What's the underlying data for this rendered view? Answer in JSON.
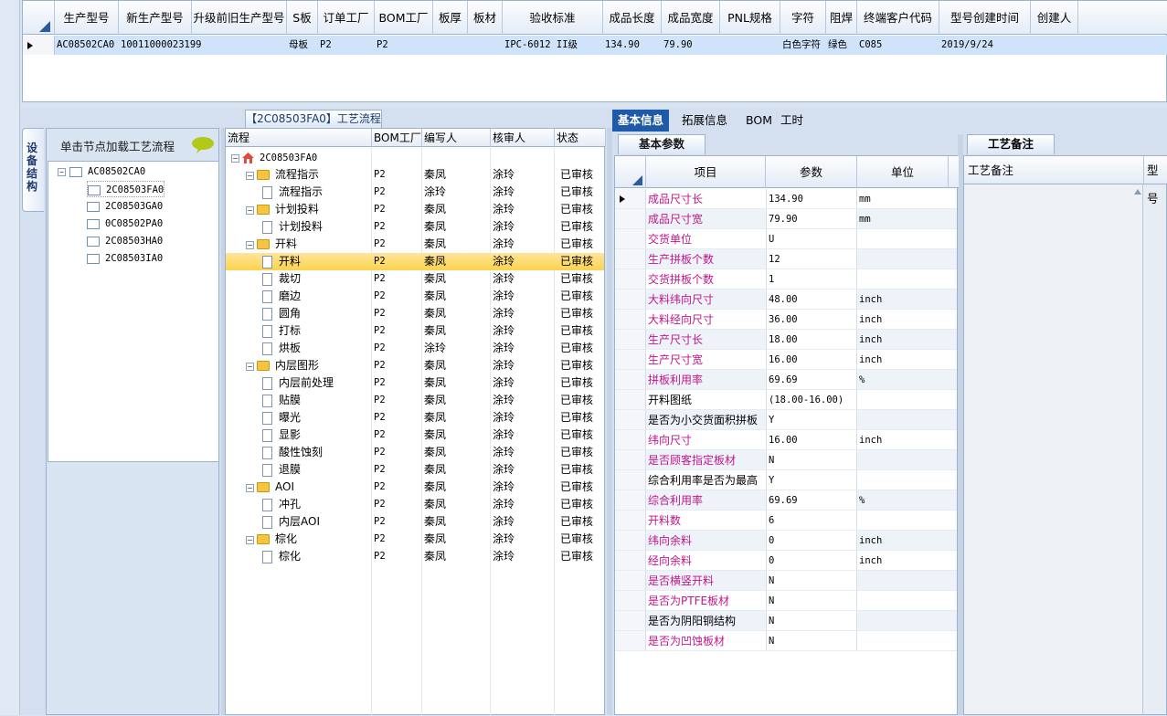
{
  "top_grid": {
    "columns": [
      "生产型号",
      "新生产型号",
      "升级前旧生产型号",
      "S板",
      "订单工厂",
      "BOM工厂",
      "板厚",
      "板材",
      "验收标准",
      "成品长度",
      "成品宽度",
      "PNL规格",
      "字符",
      "阻焊",
      "终端客户代码",
      "型号创建时间",
      "创建人"
    ],
    "row": [
      "AC08502CA0",
      "10011000023199",
      "",
      "母板",
      "P2",
      "P2",
      "",
      "",
      "IPC-6012 II级",
      "134.90",
      "79.90",
      "",
      "白色字符",
      "绿色",
      "C085",
      "2019/9/24",
      ""
    ]
  },
  "left": {
    "vtab_label": "设备结构",
    "hint": "单击节点加载工艺流程",
    "tree_root": "AC08502CA0",
    "tree_children": [
      "2C08503FA0",
      "2C08503GA0",
      "0C08502PA0",
      "2C08503HA0",
      "2C08503IA0"
    ]
  },
  "process": {
    "tab_title": "【2C08503FA0】工艺流程",
    "columns": [
      "流程",
      "BOM工厂",
      "编写人",
      "核审人",
      "状态"
    ],
    "root": "2C08503FA0",
    "rows": [
      {
        "name": "流程指示",
        "level": 1,
        "type": "folder",
        "bom": "P2",
        "writer": "秦凤",
        "reviewer": "涂玲",
        "status": "已审核"
      },
      {
        "name": "流程指示",
        "level": 2,
        "type": "doc",
        "bom": "P2",
        "writer": "涂玲",
        "reviewer": "涂玲",
        "status": "已审核"
      },
      {
        "name": "计划投料",
        "level": 1,
        "type": "folder",
        "bom": "P2",
        "writer": "秦凤",
        "reviewer": "涂玲",
        "status": "已审核"
      },
      {
        "name": "计划投料",
        "level": 2,
        "type": "doc",
        "bom": "P2",
        "writer": "秦凤",
        "reviewer": "涂玲",
        "status": "已审核"
      },
      {
        "name": "开料",
        "level": 1,
        "type": "folder",
        "bom": "P2",
        "writer": "秦凤",
        "reviewer": "涂玲",
        "status": "已审核"
      },
      {
        "name": "开料",
        "level": 2,
        "type": "doc",
        "bom": "P2",
        "writer": "秦凤",
        "reviewer": "涂玲",
        "status": "已审核",
        "selected": true
      },
      {
        "name": "裁切",
        "level": 2,
        "type": "doc",
        "bom": "P2",
        "writer": "秦凤",
        "reviewer": "涂玲",
        "status": "已审核"
      },
      {
        "name": "磨边",
        "level": 2,
        "type": "doc",
        "bom": "P2",
        "writer": "秦凤",
        "reviewer": "涂玲",
        "status": "已审核"
      },
      {
        "name": "圆角",
        "level": 2,
        "type": "doc",
        "bom": "P2",
        "writer": "秦凤",
        "reviewer": "涂玲",
        "status": "已审核"
      },
      {
        "name": "打标",
        "level": 2,
        "type": "doc",
        "bom": "P2",
        "writer": "秦凤",
        "reviewer": "涂玲",
        "status": "已审核"
      },
      {
        "name": "烘板",
        "level": 2,
        "type": "doc",
        "bom": "P2",
        "writer": "涂玲",
        "reviewer": "涂玲",
        "status": "已审核"
      },
      {
        "name": "内层图形",
        "level": 1,
        "type": "folder",
        "bom": "P2",
        "writer": "秦凤",
        "reviewer": "涂玲",
        "status": "已审核"
      },
      {
        "name": "内层前处理",
        "level": 2,
        "type": "doc",
        "bom": "P2",
        "writer": "秦凤",
        "reviewer": "涂玲",
        "status": "已审核"
      },
      {
        "name": "贴膜",
        "level": 2,
        "type": "doc",
        "bom": "P2",
        "writer": "秦凤",
        "reviewer": "涂玲",
        "status": "已审核"
      },
      {
        "name": "曝光",
        "level": 2,
        "type": "doc",
        "bom": "P2",
        "writer": "秦凤",
        "reviewer": "涂玲",
        "status": "已审核"
      },
      {
        "name": "显影",
        "level": 2,
        "type": "doc",
        "bom": "P2",
        "writer": "秦凤",
        "reviewer": "涂玲",
        "status": "已审核"
      },
      {
        "name": "酸性蚀刻",
        "level": 2,
        "type": "doc",
        "bom": "P2",
        "writer": "秦凤",
        "reviewer": "涂玲",
        "status": "已审核"
      },
      {
        "name": "退膜",
        "level": 2,
        "type": "doc",
        "bom": "P2",
        "writer": "秦凤",
        "reviewer": "涂玲",
        "status": "已审核"
      },
      {
        "name": "AOI",
        "level": 1,
        "type": "folder",
        "bom": "P2",
        "writer": "秦凤",
        "reviewer": "涂玲",
        "status": "已审核"
      },
      {
        "name": "冲孔",
        "level": 2,
        "type": "doc",
        "bom": "P2",
        "writer": "秦凤",
        "reviewer": "涂玲",
        "status": "已审核"
      },
      {
        "name": "内层AOI",
        "level": 2,
        "type": "doc",
        "bom": "P2",
        "writer": "秦凤",
        "reviewer": "涂玲",
        "status": "已审核"
      },
      {
        "name": "棕化",
        "level": 1,
        "type": "folder",
        "bom": "P2",
        "writer": "秦凤",
        "reviewer": "涂玲",
        "status": "已审核"
      },
      {
        "name": "棕化",
        "level": 2,
        "type": "doc",
        "bom": "P2",
        "writer": "秦凤",
        "reviewer": "涂玲",
        "status": "已审核"
      }
    ]
  },
  "info": {
    "tabs": [
      "基本信息",
      "拓展信息",
      "BOM",
      "工时"
    ],
    "subtab": "基本参数",
    "columns": [
      "项目",
      "参数",
      "单位"
    ],
    "rows": [
      {
        "k": "成品尺寸长",
        "v": "134.90",
        "u": "mm",
        "purple": true
      },
      {
        "k": "成品尺寸宽",
        "v": "79.90",
        "u": "mm",
        "purple": true
      },
      {
        "k": "交货单位",
        "v": "U",
        "u": "",
        "purple": true
      },
      {
        "k": "生产拼板个数",
        "v": "12",
        "u": "",
        "purple": true
      },
      {
        "k": "交货拼板个数",
        "v": "1",
        "u": "",
        "purple": true
      },
      {
        "k": "大料纬向尺寸",
        "v": "48.00",
        "u": "inch",
        "purple": true
      },
      {
        "k": "大料经向尺寸",
        "v": "36.00",
        "u": "inch",
        "purple": true
      },
      {
        "k": "生产尺寸长",
        "v": "18.00",
        "u": "inch",
        "purple": true
      },
      {
        "k": "生产尺寸宽",
        "v": "16.00",
        "u": "inch",
        "purple": true
      },
      {
        "k": "拼板利用率",
        "v": "69.69",
        "u": "%",
        "purple": true
      },
      {
        "k": "开料图纸",
        "v": "(18.00-16.00)",
        "u": "",
        "purple": false
      },
      {
        "k": "是否为小交货面积拼板",
        "v": "Y",
        "u": "",
        "purple": false
      },
      {
        "k": "纬向尺寸",
        "v": "16.00",
        "u": "inch",
        "purple": true
      },
      {
        "k": "是否顾客指定板材",
        "v": "N",
        "u": "",
        "purple": true
      },
      {
        "k": "综合利用率是否为最高",
        "v": "Y",
        "u": "",
        "purple": false
      },
      {
        "k": "综合利用率",
        "v": "69.69",
        "u": "%",
        "purple": true
      },
      {
        "k": "开料数",
        "v": "6",
        "u": "",
        "purple": true
      },
      {
        "k": "纬向余料",
        "v": "0",
        "u": "inch",
        "purple": true
      },
      {
        "k": "经向余料",
        "v": "0",
        "u": "inch",
        "purple": true
      },
      {
        "k": "是否横竖开料",
        "v": "N",
        "u": "",
        "purple": true
      },
      {
        "k": "是否为PTFE板材",
        "v": "N",
        "u": "",
        "purple": true
      },
      {
        "k": "是否为阴阳铜结构",
        "v": "N",
        "u": "",
        "purple": false
      },
      {
        "k": "是否为凹蚀板材",
        "v": "N",
        "u": "",
        "purple": true
      }
    ]
  },
  "remarks": {
    "tab": "工艺备注",
    "col1": "工艺备注",
    "col2": "型号"
  }
}
